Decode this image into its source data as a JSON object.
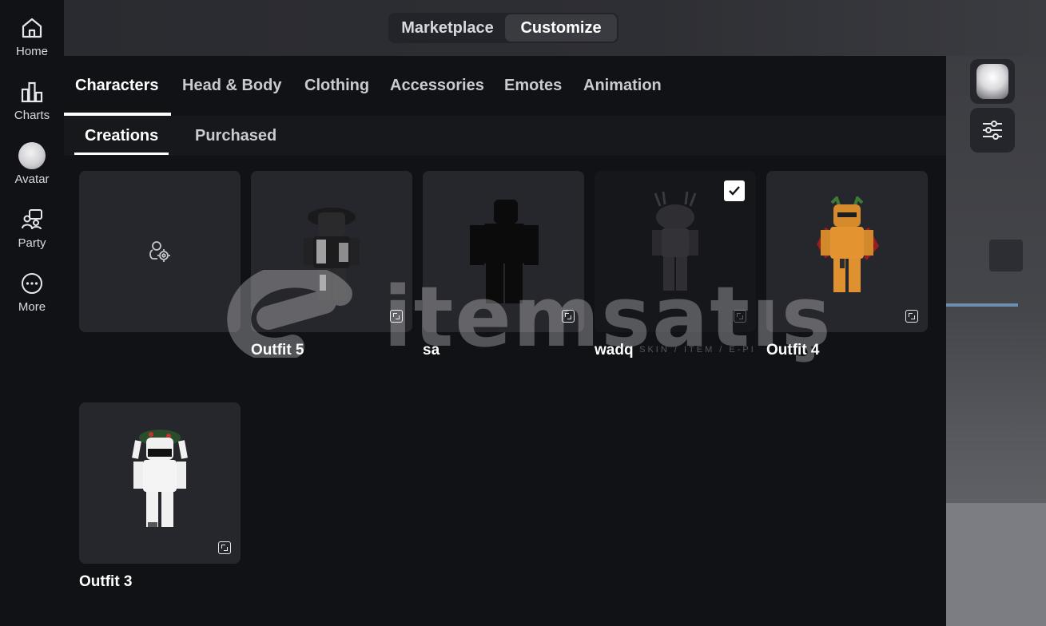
{
  "nav": {
    "items": [
      {
        "id": "home",
        "label": "Home"
      },
      {
        "id": "charts",
        "label": "Charts"
      },
      {
        "id": "avatar",
        "label": "Avatar"
      },
      {
        "id": "party",
        "label": "Party"
      },
      {
        "id": "more",
        "label": "More"
      }
    ]
  },
  "top_switch": {
    "marketplace": "Marketplace",
    "customize": "Customize",
    "selected": "Customize"
  },
  "tabs": {
    "items": [
      "Characters",
      "Head & Body",
      "Clothing",
      "Accessories",
      "Emotes",
      "Animation"
    ],
    "active": "Characters"
  },
  "subtabs": {
    "items": [
      "Creations",
      "Purchased"
    ],
    "active": "Creations"
  },
  "outfits": [
    {
      "name": "",
      "kind": "create-new",
      "icon": "character-settings-icon"
    },
    {
      "name": "Outfit 5",
      "kind": "outfit"
    },
    {
      "name": "sa",
      "kind": "outfit"
    },
    {
      "name": "wadq",
      "kind": "outfit",
      "selected": true
    },
    {
      "name": "Outfit 4",
      "kind": "outfit"
    },
    {
      "name": "Outfit 3",
      "kind": "outfit"
    }
  ],
  "watermark": {
    "text": "itemsatış",
    "tagline": "/ SKIN / ITEM / E-PI"
  },
  "colors": {
    "background": "#111216",
    "card": "#26272d",
    "accent": "#ffffff",
    "scene": "#2e2f34"
  }
}
